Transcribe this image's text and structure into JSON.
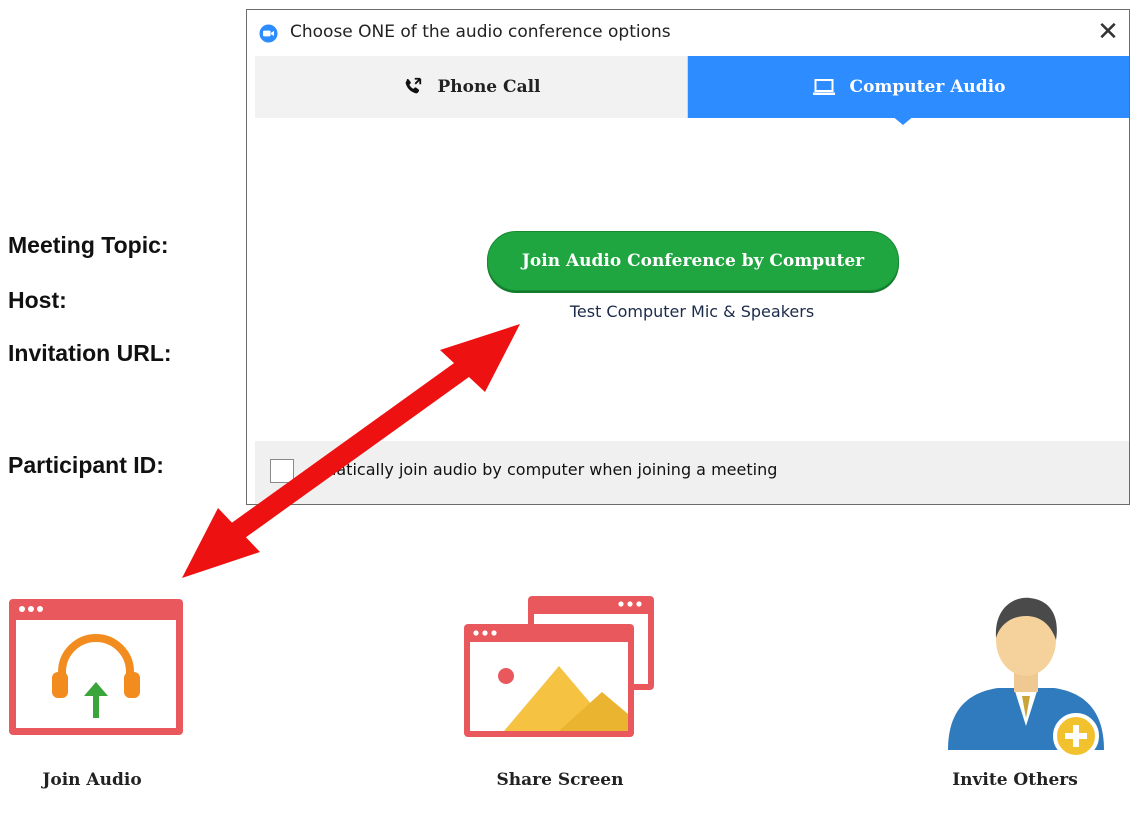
{
  "info_labels": {
    "meeting_topic": "Meeting Topic:",
    "host": "Host:",
    "invitation_url": "Invitation URL:",
    "participant_id": "Participant ID:"
  },
  "dialog": {
    "title": "Choose ONE of the audio conference options",
    "close_glyph": "✕",
    "tabs": {
      "phone_call": "Phone Call",
      "computer_audio": "Computer Audio",
      "active": "computer_audio"
    },
    "join_button": "Join Audio Conference by Computer",
    "test_link": "Test Computer Mic & Speakers",
    "auto_join_checkbox": {
      "label": "omatically join audio by computer when joining a meeting",
      "checked": false
    }
  },
  "actions": {
    "join_audio": "Join Audio",
    "share_screen": "Share Screen",
    "invite_others": "Invite Others"
  },
  "colors": {
    "accent_blue": "#2d8cff",
    "join_green": "#1fa640",
    "arrow_red": "#ee1111",
    "window_red": "#e8585d",
    "headphone_orange": "#f28c1e",
    "upload_green": "#3aa53a",
    "mountain_yellow": "#f5c242",
    "person_blue": "#2f7bbd",
    "plus_yellow": "#f2c12e"
  },
  "icons": {
    "app": "zoom-logo-icon",
    "phone": "phone-icon",
    "computer": "laptop-icon",
    "join_audio": "headphones-upload-icon",
    "share_screen": "share-screen-icon",
    "invite_others": "add-person-icon"
  }
}
